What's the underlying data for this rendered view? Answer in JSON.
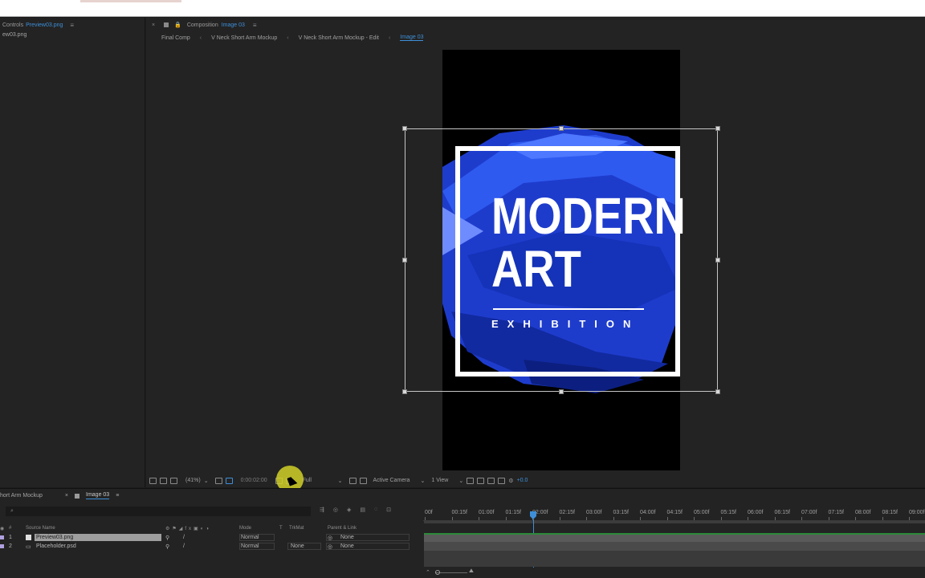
{
  "left_panel": {
    "title_prefix": "Controls",
    "title_file": "Preview03.png",
    "row_file": "ew03.png"
  },
  "composition": {
    "label": "Composition",
    "name": "Image 03",
    "breadcrumbs": [
      "Final Comp",
      "V Neck Short Arm Mockup",
      "V Neck Short Arm Mockup - Edit",
      "Image 03"
    ]
  },
  "artwork": {
    "title": "MODERN\nART",
    "subtitle": "EXHIBITION"
  },
  "viewer_toolbar": {
    "zoom": "(41%)",
    "timecode": "0:00:02:00",
    "resolution": "Full",
    "camera": "Active Camera",
    "views": "1 View",
    "exposure": "+0.0"
  },
  "timeline": {
    "tabs": [
      "hort Arm Mockup",
      "Image 03"
    ],
    "search_icon": "⌕",
    "columns": {
      "source_name": "Source Name",
      "mode": "Mode",
      "t": "T",
      "trkmat": "TrkMat",
      "parent": "Parent & Link"
    },
    "layers": [
      {
        "num": "1",
        "name": "Preview03.png",
        "mode": "Normal",
        "trkmat": "",
        "parent": "None"
      },
      {
        "num": "2",
        "name": "Placeholder.psd",
        "mode": "Normal",
        "trkmat": "None",
        "parent": "None"
      }
    ],
    "ruler": [
      "00f",
      "00:15f",
      "01:00f",
      "01:15f",
      "02:00f",
      "02:15f",
      "03:00f",
      "03:15f",
      "04:00f",
      "04:15f",
      "05:00f",
      "05:15f",
      "06:00f",
      "06:15f",
      "07:00f",
      "07:15f",
      "08:00f",
      "08:15f",
      "09:00f"
    ]
  },
  "colors": {
    "accent": "#3e8fd8",
    "paint_blue": "#1f3fd8"
  }
}
